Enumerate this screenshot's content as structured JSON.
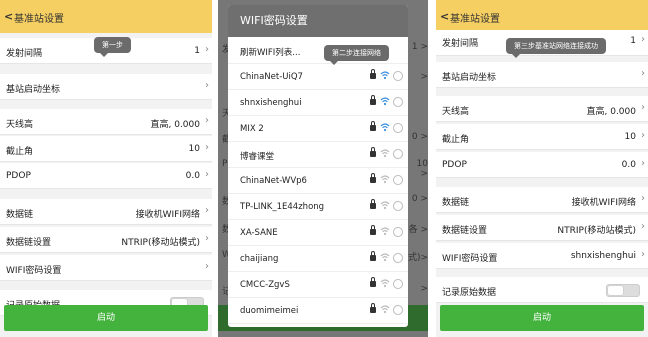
{
  "header": {
    "title": "基准站设置",
    "back_glyph": "<"
  },
  "p1": {
    "rows": [
      {
        "label": "发射间隔",
        "value": "1"
      },
      {
        "label": "基站启动坐标",
        "value": ""
      },
      {
        "label": "天线高",
        "value": "直高, 0.000"
      },
      {
        "label": "截止角",
        "value": "10"
      },
      {
        "label": "PDOP",
        "value": "0.0"
      },
      {
        "label": "数据链",
        "value": "接收机WIFI网络"
      },
      {
        "label": "数据链设置",
        "value": "NTRIP(移动站模式)"
      },
      {
        "label": "WIFI密码设置",
        "value": ""
      },
      {
        "label": "记录原始数据"
      }
    ],
    "tip": "第一步",
    "start": "启动"
  },
  "p2": {
    "dialog_title": "WIFI密码设置",
    "refresh": "刷新WIFI列表...",
    "tip": "第二步连接网络",
    "networks": [
      "ChinaNet-UiQ7",
      "shnxishenghui",
      "MIX 2",
      "博睿课堂",
      "ChinaNet-WVp6",
      "TP-LINK_1E44zhong",
      "XA-SANE",
      "chaijiang",
      "CMCC-ZgvS",
      "duomimeimei"
    ],
    "bg_left": [
      "发",
      "天",
      "截",
      "PD",
      "数",
      "数",
      "WI",
      "记"
    ],
    "bg_right": [
      "1 >",
      ">",
      "0 >",
      "10 >",
      "0 >",
      "各 >",
      "式)>",
      ">"
    ]
  },
  "p3": {
    "rows": [
      {
        "label": "发射间隔",
        "value": "1"
      },
      {
        "label": "基站启动坐标",
        "value": ""
      },
      {
        "label": "天线高",
        "value": "直高, 0.000"
      },
      {
        "label": "截止角",
        "value": "10"
      },
      {
        "label": "PDOP",
        "value": "0.0"
      },
      {
        "label": "数据链",
        "value": "接收机WIFI网络"
      },
      {
        "label": "数据链设置",
        "value": "NTRIP(移动站模式)"
      },
      {
        "label": "WIFI密码设置",
        "value": "shnxishenghui"
      },
      {
        "label": "记录原始数据"
      }
    ],
    "tip": "第三步基准站网络连接成功",
    "start": "启动"
  },
  "colors": {
    "header": "#f6cf62",
    "start": "#44b33e",
    "wifi_signal": "#3a8fe0",
    "wifi_signal_dim": "#bbbbbb"
  }
}
